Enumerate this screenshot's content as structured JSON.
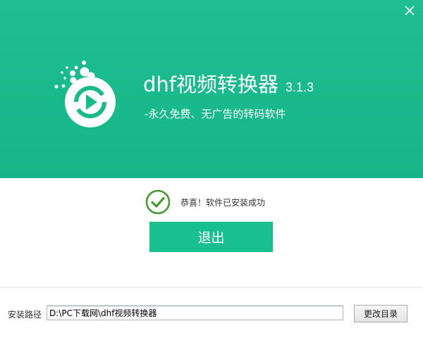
{
  "app": {
    "title": "dhf视频转换器",
    "version": "3.1.3",
    "tagline": "-永久免费、无广告的转码软件"
  },
  "window": {
    "close_icon": "close-icon"
  },
  "status": {
    "icon": "check-circle-icon",
    "message": "恭喜！软件已安装成功"
  },
  "actions": {
    "exit_label": "退出",
    "change_dir_label": "更改目录"
  },
  "install": {
    "path_label": "安装路径",
    "path_value": "D:\\PC下载网\\dhf视频转换器"
  },
  "colors": {
    "brand": "#18b98a",
    "button": "#19bf8c",
    "check": "#3f9a2c"
  }
}
